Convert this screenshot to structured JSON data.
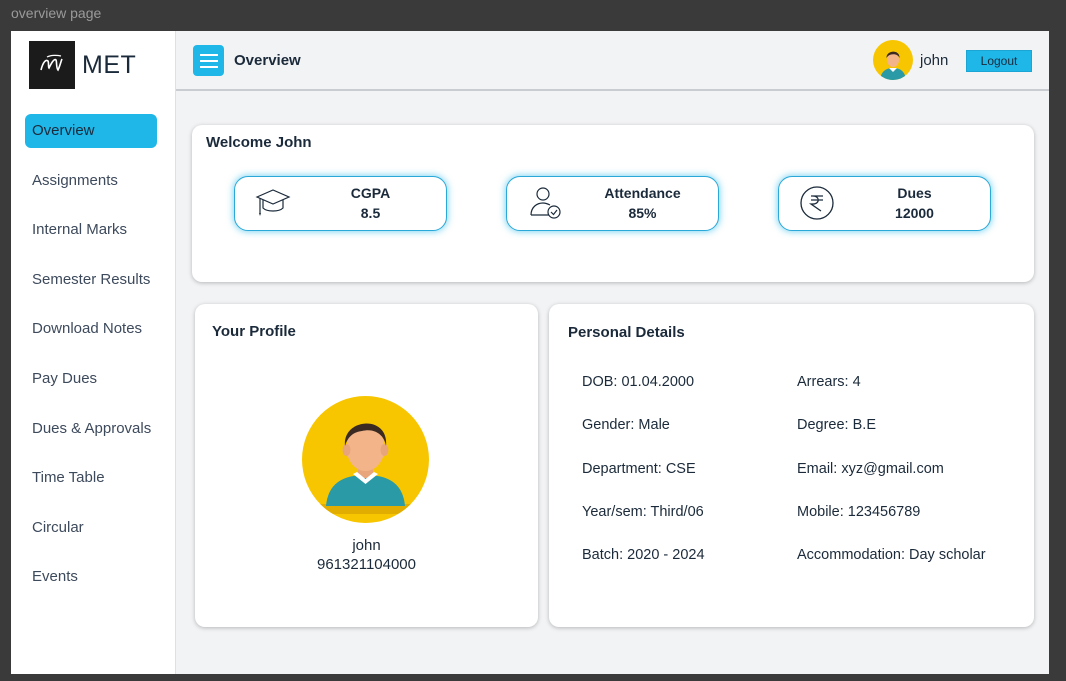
{
  "window_title": "overview page",
  "brand": {
    "name": "MET"
  },
  "sidebar": {
    "items": [
      {
        "label": "Overview",
        "active": true
      },
      {
        "label": "Assignments"
      },
      {
        "label": "Internal Marks"
      },
      {
        "label": "Semester Results"
      },
      {
        "label": "Download Notes"
      },
      {
        "label": "Pay Dues"
      },
      {
        "label": "Dues & Approvals"
      },
      {
        "label": "Time Table"
      },
      {
        "label": "Circular"
      },
      {
        "label": "Events"
      }
    ]
  },
  "header": {
    "title": "Overview",
    "user": "john",
    "logout_label": "Logout"
  },
  "welcome": {
    "title": "Welcome John",
    "stats": [
      {
        "label": "CGPA",
        "value": "8.5",
        "icon": "graduation-cap-icon"
      },
      {
        "label": "Attendance",
        "value": "85%",
        "icon": "user-check-icon"
      },
      {
        "label": "Dues",
        "value": "12000",
        "icon": "rupee-icon"
      }
    ]
  },
  "profile": {
    "title": "Your Profile",
    "name": "john",
    "id": "961321104000"
  },
  "personal_details": {
    "title": "Personal Details",
    "left": [
      "DOB: 01.04.2000",
      "Gender: Male",
      "Department: CSE",
      "Year/sem: Third/06",
      "Batch: 2020 - 2024"
    ],
    "right": [
      "Arrears: 4",
      "Degree: B.E",
      "Email: xyz@gmail.com",
      "Mobile: 123456789",
      "Accommodation: Day scholar"
    ]
  },
  "colors": {
    "accent": "#1fb6e8",
    "avatar_bg": "#f7c600",
    "text": "#1b2a3a"
  }
}
